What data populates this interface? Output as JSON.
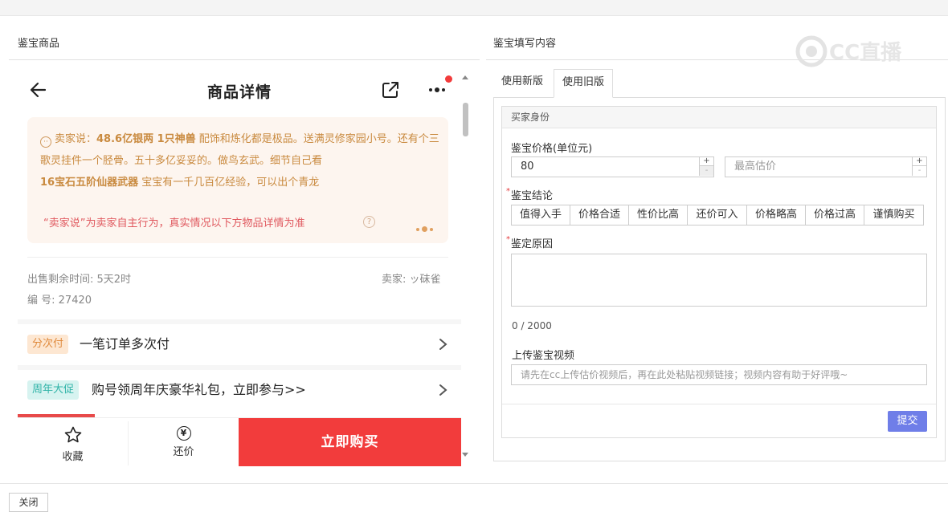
{
  "left_section_title": "鉴宝商品",
  "right_section_title": "鉴宝填写内容",
  "phone": {
    "title": "商品详情",
    "seller_says": {
      "prefix": "卖家说：",
      "bold1": "48.6亿银两 1只神兽",
      "text1": " 配饰和炼化都是极品。送满灵修家园小号。还有个三歌灵挂件一个胫骨。五十多亿妥妥的。做鸟玄武。细节自己看",
      "bold2": "16宝石五阶仙器武器",
      "text2": " 宝宝有一千几百亿经验，可以出个青龙"
    },
    "disclaimer": "“卖家说”为卖家自主行为，真实情况以下方物品详情为准",
    "help_symbol": "?",
    "time_left_label": "出售剩余时间: ",
    "time_left_value": "5天2时",
    "seller_label": "卖家: ",
    "seller_name": "ッ砞雀",
    "serial_label": "编 号: ",
    "serial_value": "27420",
    "installment_tag": "分次付",
    "installment_text": "一笔订单多次付",
    "promo_tag": "周年大促",
    "promo_text": "购号领周年庆豪华礼包，立即参与>>",
    "favorite_label": "收藏",
    "bargain_label": "还价",
    "bargain_symbol": "¥",
    "buy_label": "立即购买"
  },
  "form": {
    "tabs": [
      "使用新版",
      "使用旧版"
    ],
    "active_tab": "使用旧版",
    "header": "买家身份",
    "price_label": "鉴宝价格(单位元)",
    "price_value": "80",
    "max_price_placeholder": "最高估价",
    "conclusion_label": "鉴宝结论",
    "conclusions": [
      "值得入手",
      "价格合适",
      "性价比高",
      "还价可入",
      "价格略高",
      "价格过高",
      "谨慎购买"
    ],
    "reason_label": "鉴定原因",
    "counter": "0 / 2000",
    "video_label": "上传鉴宝视频",
    "video_placeholder": "请先在cc上传估价视频后，再在此处粘贴视频链接；视频内容有助于好评哦~",
    "submit_label": "提交",
    "spin_up": "+",
    "spin_down": "-"
  },
  "watermark": "CC直播",
  "close_label": "关闭",
  "colors": {
    "buy_red": "#f23c3c",
    "submit_blue": "#6f7ee8",
    "seller_text": "#c98a3f",
    "disclaimer": "#e0595f"
  }
}
